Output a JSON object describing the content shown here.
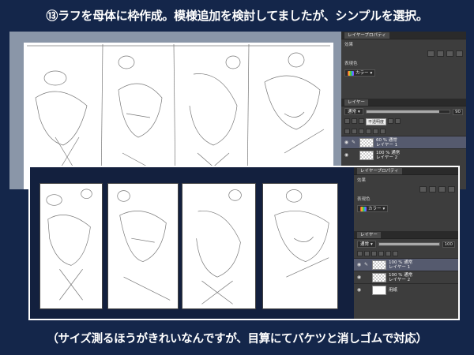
{
  "captions": {
    "top": "⑬ラフを母体に枠作成。模様追加を検討してましたが、シンプルを選択。",
    "bottom": "（サイズ測るほうがきれいなんですが、目算にてバケツと消しゴムで対応）"
  },
  "top_panel": {
    "tab": "レイヤープロパティ",
    "effect_label": "効果",
    "color_label": "表現色",
    "color_value": "カラー",
    "layer_tab": "レイヤー",
    "blend_mode": "通常",
    "opacity": "90",
    "tooltip": "不透明度",
    "layers": [
      {
        "percent": "60 %  通常",
        "name": "レイヤー 1"
      },
      {
        "percent": "100 %  通常",
        "name": "レイヤー 2"
      }
    ]
  },
  "bottom_panel": {
    "tab": "レイヤープロパティ",
    "effect_label": "効果",
    "color_label": "表現色",
    "color_value": "カラー",
    "layer_tab": "レイヤー",
    "blend_mode": "通常",
    "opacity": "100",
    "layers": [
      {
        "percent": "100 %  通常",
        "name": "レイヤー 1"
      },
      {
        "percent": "100 %  通常",
        "name": "レイヤー 2"
      },
      {
        "percent": "",
        "name": "用紙"
      }
    ]
  },
  "icons": {
    "visibility": "eye-icon",
    "edit": "pen-icon",
    "dropdown": "chevron-down-icon"
  }
}
